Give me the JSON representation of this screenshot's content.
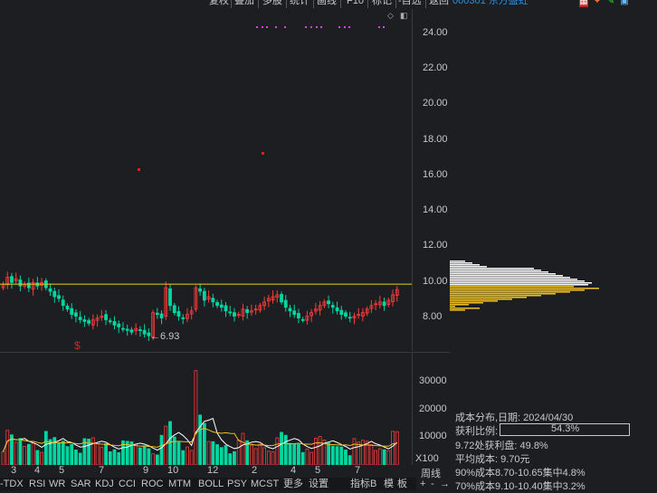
{
  "toolbar": {
    "buttons": [
      "复权",
      "叠加",
      "多股",
      "统计",
      "画线",
      "F10",
      "标记",
      "-自选",
      "返回"
    ],
    "stock_title": "000301 东方盛虹"
  },
  "chart_data": [
    {
      "type": "candlestick",
      "title": "",
      "price_axis": {
        "ticks": [
          "24.00",
          "22.00",
          "20.00",
          "18.00",
          "16.00",
          "14.00",
          "12.00",
          "10.00",
          "8.00"
        ],
        "range": [
          7.0,
          25.0
        ]
      },
      "x_ticks": [
        "3",
        "4",
        "5",
        "7",
        "9",
        "10",
        "12",
        "2",
        "4",
        "5",
        "7"
      ],
      "reference_line": 10.2,
      "low_annotation": "←6.93",
      "candles_close": [
        10.2,
        10.6,
        10.3,
        10.5,
        10.1,
        10.2,
        10.0,
        10.3,
        10.1,
        10.3,
        10.0,
        9.8,
        9.5,
        9.4,
        9.0,
        8.8,
        8.5,
        8.4,
        8.2,
        8.1,
        8.0,
        8.2,
        8.3,
        8.4,
        8.2,
        8.1,
        7.9,
        7.8,
        7.7,
        7.6,
        7.5,
        7.7,
        7.6,
        7.4,
        7.3,
        8.6,
        8.5,
        8.3,
        10.0,
        9.0,
        8.6,
        8.4,
        8.3,
        8.5,
        8.7,
        10.0,
        9.8,
        9.3,
        9.5,
        9.2,
        9.0,
        8.9,
        8.7,
        8.6,
        8.4,
        8.5,
        8.8,
        8.6,
        8.7,
        8.8,
        9.0,
        9.2,
        9.4,
        9.5,
        9.6,
        9.2,
        8.9,
        8.7,
        8.5,
        8.3,
        8.2,
        8.4,
        8.6,
        8.8,
        9.0,
        9.2,
        9.1,
        8.9,
        8.7,
        8.5,
        8.4,
        8.3,
        8.4,
        8.5,
        8.6,
        8.8,
        9.0,
        9.1,
        9.2,
        9.0,
        9.3,
        9.6,
        9.9
      ],
      "volume_axis": {
        "ticks": [
          "30000",
          "20000",
          "10000"
        ],
        "unit": "X100"
      }
    }
  ],
  "info_panel": {
    "line1": "成本分布,日期: 2024/04/30",
    "line2_label": "获利比例:",
    "line2_value": "54.3%",
    "line2_fraction": 0.543,
    "line3": "9.72处获利盘: 49.8%",
    "line4": "平均成本: 9.70元",
    "line5": "90%成本8.70-10.65集中4.8%",
    "line6": "70%成本9.10-10.40集中3.2%"
  },
  "period_label": "周线",
  "bottom_tabs": [
    "-TDX",
    "RSI",
    "WR",
    "SAR",
    "KDJ",
    "CCI",
    "ROC",
    "MTM",
    "BOLL",
    "PSY",
    "MCST",
    "更多",
    "设置",
    "指标B",
    "模",
    "板"
  ],
  "corner_controls": [
    "+",
    "-",
    "→"
  ],
  "colors": {
    "up": "#ff3a3a",
    "down": "#00d6a0",
    "ma_white": "#ffffff",
    "ma_yellow": "#f0c020",
    "cost_yellow": "#f0c020",
    "title_blue": "#2a8fd8",
    "magenta": "#e040e0"
  }
}
